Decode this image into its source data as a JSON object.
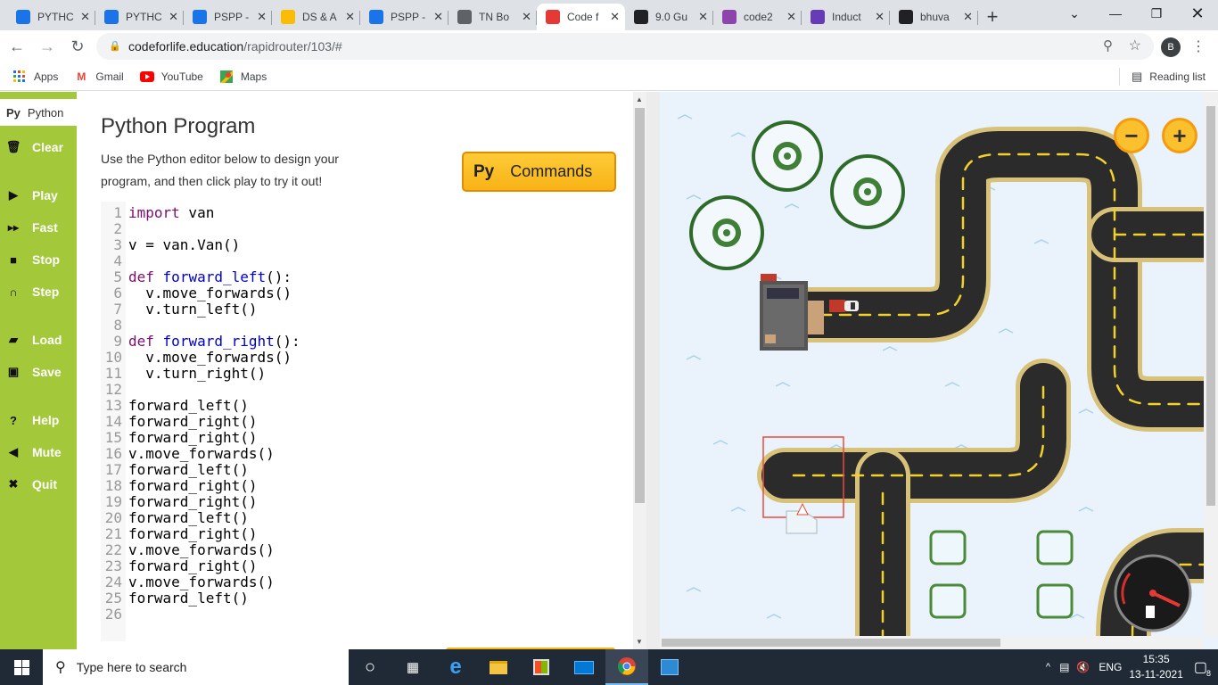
{
  "browser": {
    "tabs": [
      {
        "label": "PYTHC",
        "icon": "pyschool-icon",
        "color": "#1a73e8"
      },
      {
        "label": "PYTHC",
        "icon": "pyschool-icon",
        "color": "#1a73e8"
      },
      {
        "label": "PSPP -",
        "icon": "pyschool-icon",
        "color": "#1a73e8"
      },
      {
        "label": "DS & A",
        "icon": "drive-icon",
        "color": "#fbbc04"
      },
      {
        "label": "PSPP -",
        "icon": "pyschool-icon",
        "color": "#1a73e8"
      },
      {
        "label": "TN Bo",
        "icon": "globe-icon",
        "color": "#5f6368"
      },
      {
        "label": "Code f",
        "icon": "codeforlife-icon",
        "color": "#e53935"
      },
      {
        "label": "9.0 Gu",
        "icon": "guide-icon",
        "color": "#202124"
      },
      {
        "label": "code2",
        "icon": "code-icon",
        "color": "#8e44ad"
      },
      {
        "label": "Induct",
        "icon": "form-icon",
        "color": "#673ab7"
      },
      {
        "label": "bhuva",
        "icon": "github-icon",
        "color": "#202124"
      }
    ],
    "url_host": "codeforlife.education",
    "url_path": "/rapidrouter/103/#",
    "profile_initial": "B",
    "bookmarks": [
      {
        "label": "Apps",
        "icon": "apps-grid-icon"
      },
      {
        "label": "Gmail",
        "icon": "gmail-icon"
      },
      {
        "label": "YouTube",
        "icon": "youtube-icon"
      },
      {
        "label": "Maps",
        "icon": "maps-icon"
      }
    ],
    "reading_list": "Reading list"
  },
  "sidebar": {
    "tab_prefix": "Py",
    "tab_label": "Python",
    "buttons": [
      {
        "label": "Clear",
        "icon": "trash-icon"
      },
      {
        "label": "Play",
        "icon": "play-icon"
      },
      {
        "label": "Fast",
        "icon": "fast-forward-icon"
      },
      {
        "label": "Stop",
        "icon": "stop-icon"
      },
      {
        "label": "Step",
        "icon": "step-icon"
      },
      {
        "label": "Load",
        "icon": "folder-icon"
      },
      {
        "label": "Save",
        "icon": "save-icon"
      },
      {
        "label": "Help",
        "icon": "help-icon"
      },
      {
        "label": "Mute",
        "icon": "speaker-icon"
      },
      {
        "label": "Quit",
        "icon": "close-icon"
      }
    ]
  },
  "editor": {
    "title": "Python Program",
    "description": "Use the Python editor below to design your program, and then click play to try it out!",
    "commands_prefix": "Py",
    "commands_label": "Commands",
    "lines": [
      "import van",
      "",
      "v = van.Van()",
      "",
      "def forward_left():",
      "  v.move_forwards()",
      "  v.turn_left()",
      "",
      "def forward_right():",
      "  v.move_forwards()",
      "  v.turn_right()",
      "",
      "forward_left()",
      "forward_right()",
      "forward_right()",
      "v.move_forwards()",
      "forward_left()",
      "forward_right()",
      "forward_right()",
      "forward_left()",
      "forward_right()",
      "v.move_forwards()",
      "forward_right()",
      "v.move_forwards()",
      "forward_left()",
      ""
    ]
  },
  "game": {
    "zoom_out": "−",
    "zoom_in": "+",
    "accent": "#fbc02d",
    "road": "#2b2b2b",
    "road_edge": "#d8c27a"
  },
  "taskbar": {
    "search_placeholder": "Type here to search",
    "language": "ENG",
    "time": "15:35",
    "date": "13-11-2021",
    "notifications": "8"
  }
}
